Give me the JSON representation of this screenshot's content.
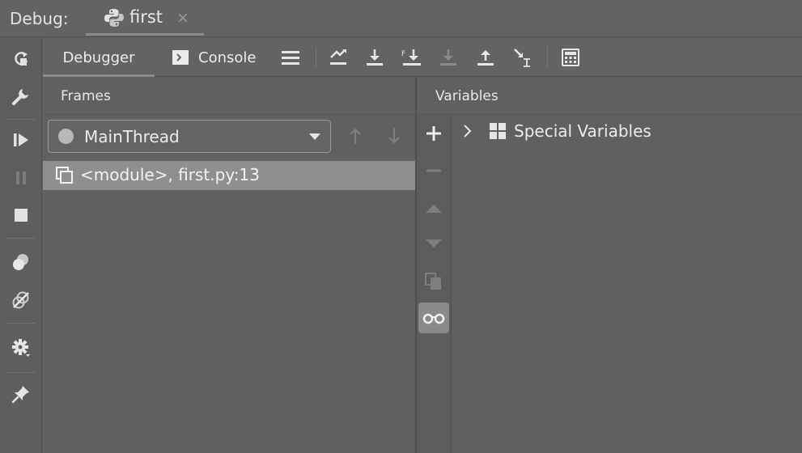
{
  "window": {
    "title_label": "Debug:",
    "file_tab": {
      "label": "first",
      "icon": "python-icon",
      "close": "×"
    }
  },
  "toolbar": {
    "tabs": [
      {
        "label": "Debugger",
        "active": true
      },
      {
        "label": "Console",
        "active": false,
        "icon": "console-prompt-icon"
      }
    ],
    "actions": [
      "layout-menu-icon",
      "show-execution-point-icon",
      "step-over-icon",
      "step-into-my-code-icon",
      "step-into-disabled-icon",
      "step-out-icon",
      "run-to-cursor-icon",
      "evaluate-expression-icon"
    ]
  },
  "left_toolbar": {
    "actions": [
      "rerun-icon",
      "settings-wrench-icon",
      "resume-icon",
      "pause-icon",
      "stop-icon",
      "view-breakpoints-icon",
      "mute-breakpoints-icon",
      "gear-icon",
      "pin-icon"
    ]
  },
  "frames": {
    "header": "Frames",
    "thread": {
      "label": "MainThread",
      "status_color": "#b8b8b8"
    },
    "rows": [
      {
        "label": "<module>, first.py:13",
        "selected": true
      }
    ]
  },
  "variables": {
    "header": "Variables",
    "strip_actions": [
      "add-watch-icon",
      "remove-watch-icon",
      "move-up-icon",
      "move-down-icon",
      "copy-icon",
      "show-watches-icon"
    ],
    "rows": [
      {
        "label": "Special Variables",
        "expanded": false
      }
    ]
  },
  "colors": {
    "background": "#5f5f5f",
    "selection": "#8f8f8f",
    "text": "#e6e6e6"
  }
}
